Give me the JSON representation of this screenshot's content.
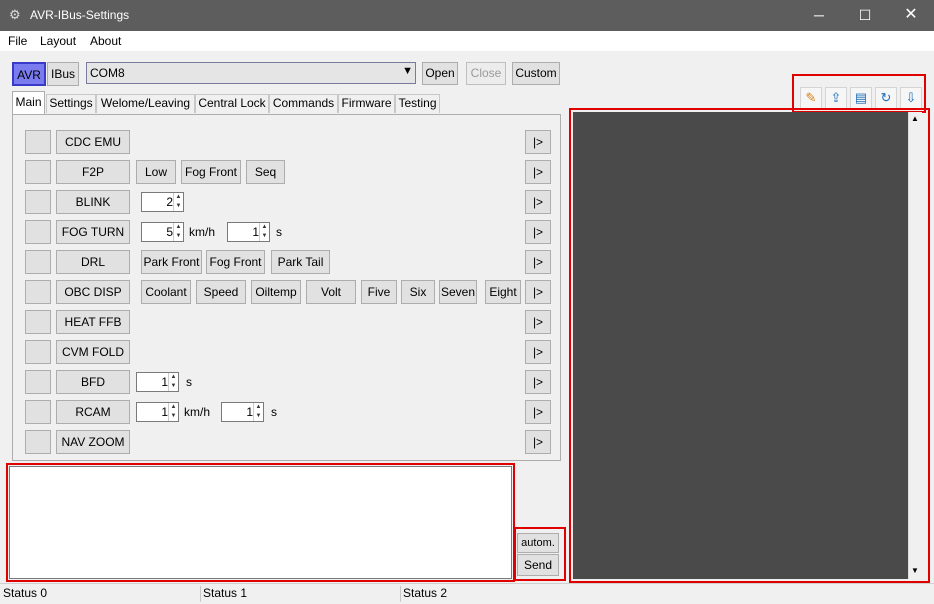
{
  "window": {
    "title": "AVR-IBus-Settings"
  },
  "menu": [
    "File",
    "Layout",
    "About"
  ],
  "mode": {
    "avr": "AVR",
    "ibus": "IBus"
  },
  "port": {
    "value": "COM8",
    "open": "Open",
    "close": "Close",
    "custom": "Custom"
  },
  "tabs": [
    "Main",
    "Settings",
    "Welome/Leaving",
    "Central Lock",
    "Commands",
    "Firmware",
    "Testing"
  ],
  "rows": {
    "cdc": {
      "label": "CDC EMU"
    },
    "f2p": {
      "label": "F2P",
      "opt1": "Low",
      "opt2": "Fog Front",
      "opt3": "Seq"
    },
    "blink": {
      "label": "BLINK",
      "count": "2"
    },
    "fogturn": {
      "label": "FOG TURN",
      "speed": "5",
      "speed_unit": "km/h",
      "time": "1",
      "time_unit": "s"
    },
    "drl": {
      "label": "DRL",
      "opt1": "Park Front",
      "opt2": "Fog Front",
      "opt3": "Park Tail"
    },
    "obc": {
      "label": "OBC DISP",
      "opts": [
        "Coolant",
        "Speed",
        "Oiltemp",
        "Volt",
        "Five",
        "Six",
        "Seven",
        "Eight"
      ]
    },
    "heat": {
      "label": "HEAT FFB"
    },
    "cvm": {
      "label": "CVM FOLD"
    },
    "bfd": {
      "label": "BFD",
      "time": "1",
      "time_unit": "s"
    },
    "rcam": {
      "label": "RCAM",
      "speed": "1",
      "speed_unit": "km/h",
      "time": "1",
      "time_unit": "s"
    },
    "nav": {
      "label": "NAV ZOOM"
    }
  },
  "arrow_label": "|>",
  "send": {
    "auto": "autom.",
    "send": "Send"
  },
  "toolbar_icons": [
    "eraser-icon",
    "export-icon",
    "save-icon",
    "refresh-icon",
    "scroll-lock-icon"
  ],
  "status": [
    "Status 0",
    "Status 1",
    "Status 2"
  ]
}
